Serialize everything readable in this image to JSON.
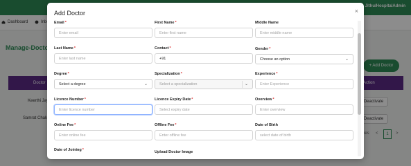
{
  "header": {
    "user": "Jithu/HospitalAdmin"
  },
  "nav": {
    "dashboard": "Dashboard",
    "inbox": "Inbo"
  },
  "page": {
    "title": "Manage-Doctor",
    "add_button": "+ Add Doctor"
  },
  "table": {
    "headers": [
      "Doctor",
      "Action"
    ],
    "rows": [
      {
        "name_fragment": "Keerthi Jaya",
        "action": "Deactivate"
      },
      {
        "name_fragment": "Samrat Chakra",
        "action": "Deactivate"
      }
    ],
    "pager": {
      "entries_label": "ries",
      "prev": "<",
      "current": "1",
      "next": ">"
    }
  },
  "modal": {
    "title": "Add Doctor",
    "close": "×",
    "fields": {
      "email": {
        "label": "Email",
        "required": "*",
        "placeholder": "Enter email"
      },
      "first_name": {
        "label": "First Name",
        "required": "*",
        "placeholder": "Enter first name"
      },
      "middle_name": {
        "label": "Middle Name",
        "placeholder": "Enter middle name"
      },
      "last_name": {
        "label": "Last Name",
        "required": "*",
        "placeholder": "Enter last name"
      },
      "contact": {
        "label": "Contact",
        "required": "*",
        "value": "+91"
      },
      "gender": {
        "label": "Gender",
        "required": "*",
        "selected": "Choose an option"
      },
      "degree": {
        "label": "Degree",
        "required": "*",
        "selected": "Select a degree"
      },
      "specialization": {
        "label": "Specialization",
        "required": "*",
        "selected": "Select a specialization"
      },
      "experience": {
        "label": "Experience",
        "required": "*",
        "placeholder": "Enter Experience"
      },
      "licence_number": {
        "label": "Licence Number",
        "required": "*",
        "placeholder": "Enter licence number"
      },
      "licence_expiry": {
        "label": "Licence Expiry Date",
        "required": "*",
        "placeholder": "Select expiry date"
      },
      "overview": {
        "label": "Overview",
        "required": "*",
        "placeholder": "Enter overview"
      },
      "online_fee": {
        "label": "Online Fee",
        "required": "*",
        "placeholder": "Enter online fee"
      },
      "offline_fee": {
        "label": "Offline Fee",
        "required": "*",
        "placeholder": "Enter offline fee"
      },
      "dob": {
        "label": "Date of Birth",
        "placeholder": "select date of birth"
      },
      "joining": {
        "label": "Date of Joining",
        "required": "*"
      },
      "upload_image": {
        "label": "Upload Doctor Image"
      }
    }
  },
  "colors": {
    "brand_green": "#2e8b57",
    "table_header_purple": "#5b2a86",
    "required_red": "#d33333"
  },
  "icons": {
    "dashboard": "home-icon",
    "inbox": "inbox-icon",
    "close": "close-icon",
    "chevron": "chevron-down-icon"
  }
}
